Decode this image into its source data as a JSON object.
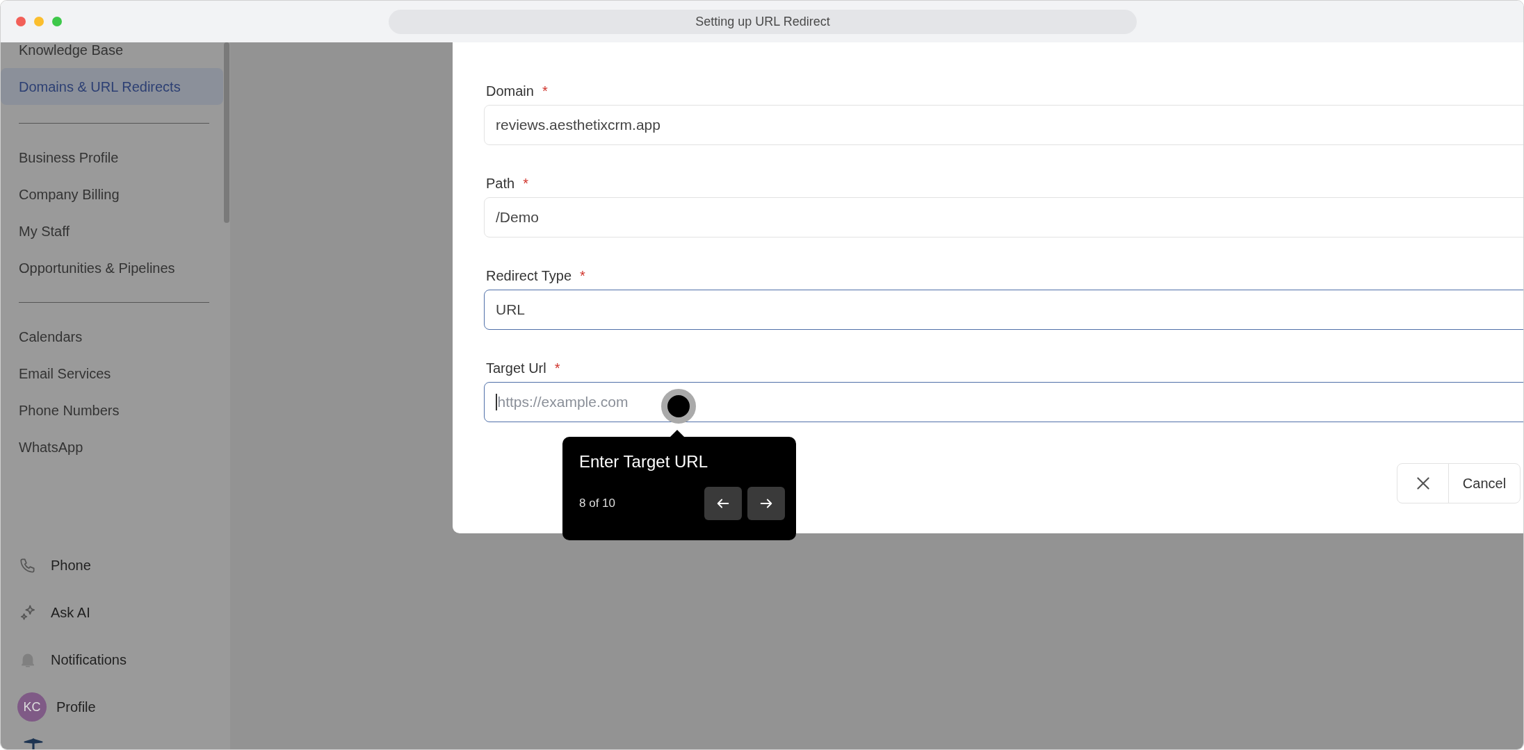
{
  "window": {
    "title": "Setting up URL Redirect"
  },
  "sidebar": {
    "groups": [
      {
        "items": [
          {
            "label": "Knowledge Base",
            "selected": false
          },
          {
            "label": "Domains & URL Redirects",
            "selected": true
          }
        ]
      },
      {
        "items": [
          {
            "label": "Business Profile",
            "selected": false
          },
          {
            "label": "Company Billing",
            "selected": false
          },
          {
            "label": "My Staff",
            "selected": false
          },
          {
            "label": "Opportunities & Pipelines",
            "selected": false
          }
        ]
      },
      {
        "items": [
          {
            "label": "Calendars",
            "selected": false
          },
          {
            "label": "Email Services",
            "selected": false
          },
          {
            "label": "Phone Numbers",
            "selected": false
          },
          {
            "label": "WhatsApp",
            "selected": false
          }
        ]
      }
    ],
    "bottom_items": [
      {
        "kind": "phone",
        "label": "Phone"
      },
      {
        "kind": "sparkle",
        "label": "Ask AI"
      },
      {
        "kind": "bell",
        "label": "Notifications"
      },
      {
        "kind": "avatar",
        "initials": "KC",
        "label": "Profile"
      }
    ]
  },
  "form": {
    "fields": [
      {
        "label": "Domain",
        "required_mark": "*",
        "value": "reviews.aesthetixcrm.app",
        "highlighted": false,
        "caret": false
      },
      {
        "label": "Path",
        "required_mark": "*",
        "value": "/Demo",
        "highlighted": false,
        "caret": false
      },
      {
        "label": "Redirect Type",
        "required_mark": "*",
        "value": "URL",
        "highlighted": true,
        "caret": false
      },
      {
        "label": "Target Url",
        "required_mark": "*",
        "placeholder": "https://example.com",
        "highlighted": true,
        "caret": true
      }
    ],
    "cancel_button": {
      "label": "Cancel"
    }
  },
  "tour": {
    "title": "Enter Target URL",
    "step": "8 of 10"
  }
}
